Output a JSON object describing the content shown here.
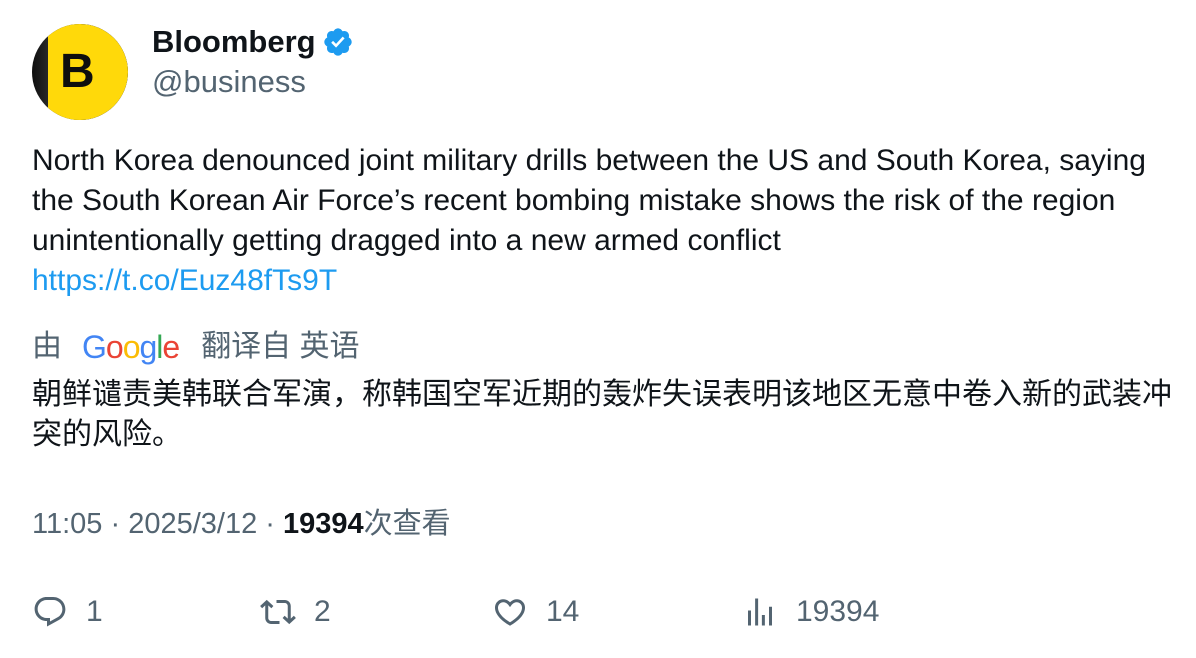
{
  "author": {
    "display_name": "Bloomberg",
    "handle": "@business",
    "avatar_letter": "B",
    "verified": true,
    "verified_color": "#1d9bf0"
  },
  "tweet": {
    "text": "North Korea denounced joint military drills between the US and South Korea, saying the South Korean Air Force’s recent bombing mistake shows the risk of the region unintentionally getting dragged into a new armed conflict",
    "link": "https://t.co/Euz48fTs9T"
  },
  "translation": {
    "by": "由",
    "provider": "Google",
    "from_label": "翻译自 英语",
    "text": "朝鲜谴责美韩联合军演，称韩国空军近期的轰炸失误表明该地区无意中卷入新的武装冲突的风险。"
  },
  "meta": {
    "time": "11:05",
    "sep1": " · ",
    "date": "2025/3/12",
    "sep2": " · ",
    "views_count": "19394",
    "views_label": "次查看"
  },
  "actions": {
    "replies": "1",
    "retweets": "2",
    "likes": "14",
    "views": "19394"
  },
  "colors": {
    "accent": "#1d9bf0",
    "text_primary": "#0f1419",
    "text_secondary": "#536471",
    "avatar_yellow": "#ffd90a"
  },
  "icons": [
    "verified-badge-icon",
    "reply-icon",
    "retweet-icon",
    "like-icon",
    "views-icon"
  ]
}
